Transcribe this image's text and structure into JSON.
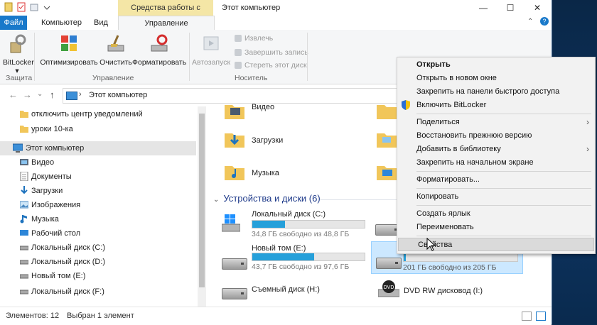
{
  "window": {
    "title": "Этот компьютер",
    "context_tab": "Средства работы с дисками",
    "controls": {
      "minimize": "—",
      "maximize": "☐",
      "close": "✕"
    }
  },
  "ribbon_tabs": {
    "file": "Файл",
    "computer": "Компьютер",
    "view": "Вид",
    "manage": "Управление"
  },
  "ribbon": {
    "bitlocker": "BitLocker",
    "bitlocker_arrow": "▾",
    "optimize": "Оптимизировать",
    "cleanup": "Очистить",
    "format": "Форматировать",
    "autoplay": "Автозапуск",
    "eject": "Извлечь",
    "finish_burn": "Завершить запись",
    "erase_disc": "Стереть этот диск",
    "group_protection": "Защита",
    "group_manage": "Управление",
    "group_media": "Носитель"
  },
  "address": {
    "back": "←",
    "forward": "→",
    "recent": "⌄",
    "up": "↑",
    "path": "Этот компьютер"
  },
  "nav": {
    "items": [
      {
        "label": "отключить центр уведомлений",
        "icon": "folder-icon"
      },
      {
        "label": "уроки 10-ка",
        "icon": "folder-icon"
      },
      {
        "label": "Этот компьютер",
        "icon": "computer-icon"
      },
      {
        "label": "Видео",
        "icon": "video-icon"
      },
      {
        "label": "Документы",
        "icon": "documents-icon"
      },
      {
        "label": "Загрузки",
        "icon": "downloads-icon"
      },
      {
        "label": "Изображения",
        "icon": "pictures-icon"
      },
      {
        "label": "Музыка",
        "icon": "music-icon"
      },
      {
        "label": "Рабочий стол",
        "icon": "desktop-icon"
      },
      {
        "label": "Локальный диск (C:)",
        "icon": "drive-icon"
      },
      {
        "label": "Локальный диск (D:)",
        "icon": "drive-icon"
      },
      {
        "label": "Новый том (E:)",
        "icon": "drive-icon"
      },
      {
        "label": "Локальный диск (F:)",
        "icon": "drive-icon"
      }
    ]
  },
  "content": {
    "folders": {
      "video": "Видео",
      "downloads": "Загрузки",
      "music": "Музыка"
    },
    "section_title": "Устройства и диски (6)",
    "drives": [
      {
        "name": "Локальный диск (C:)",
        "free": "34,8 ГБ свободно из 48,8 ГБ",
        "used_fraction": 0.29
      },
      {
        "name": "Новый том (E:)",
        "free": "43,7 ГБ свободно из 97,6 ГБ",
        "used_fraction": 0.55
      },
      {
        "name": "Съемный диск (H:)"
      },
      {
        "free": "201 ГБ свободно из 205 ГБ",
        "used_fraction": 0.02
      },
      {
        "name": "DVD RW дисковод (I:)"
      }
    ]
  },
  "status": {
    "items": "Элементов: 12",
    "selected": "Выбран 1 элемент"
  },
  "context_menu": {
    "items": [
      {
        "label": "Открыть",
        "bold": true
      },
      {
        "label": "Открыть в новом окне"
      },
      {
        "label": "Закрепить на панели быстрого доступа"
      },
      {
        "label": "Включить BitLocker",
        "icon": "shield-icon"
      },
      {
        "label": "Поделиться",
        "submenu": "›"
      },
      {
        "label": "Восстановить прежнюю версию"
      },
      {
        "label": "Добавить в библиотеку",
        "submenu": "›"
      },
      {
        "label": "Закрепить на начальном экране"
      },
      {
        "label": "Форматировать..."
      },
      {
        "label": "Копировать"
      },
      {
        "label": "Создать ярлык"
      },
      {
        "label": "Переименовать"
      },
      {
        "label": "Свойства",
        "hovered": true
      }
    ]
  },
  "colors": {
    "accent": "#1979ca",
    "context_tab": "#f4e6a6",
    "drive_bar": "#26a0da"
  }
}
